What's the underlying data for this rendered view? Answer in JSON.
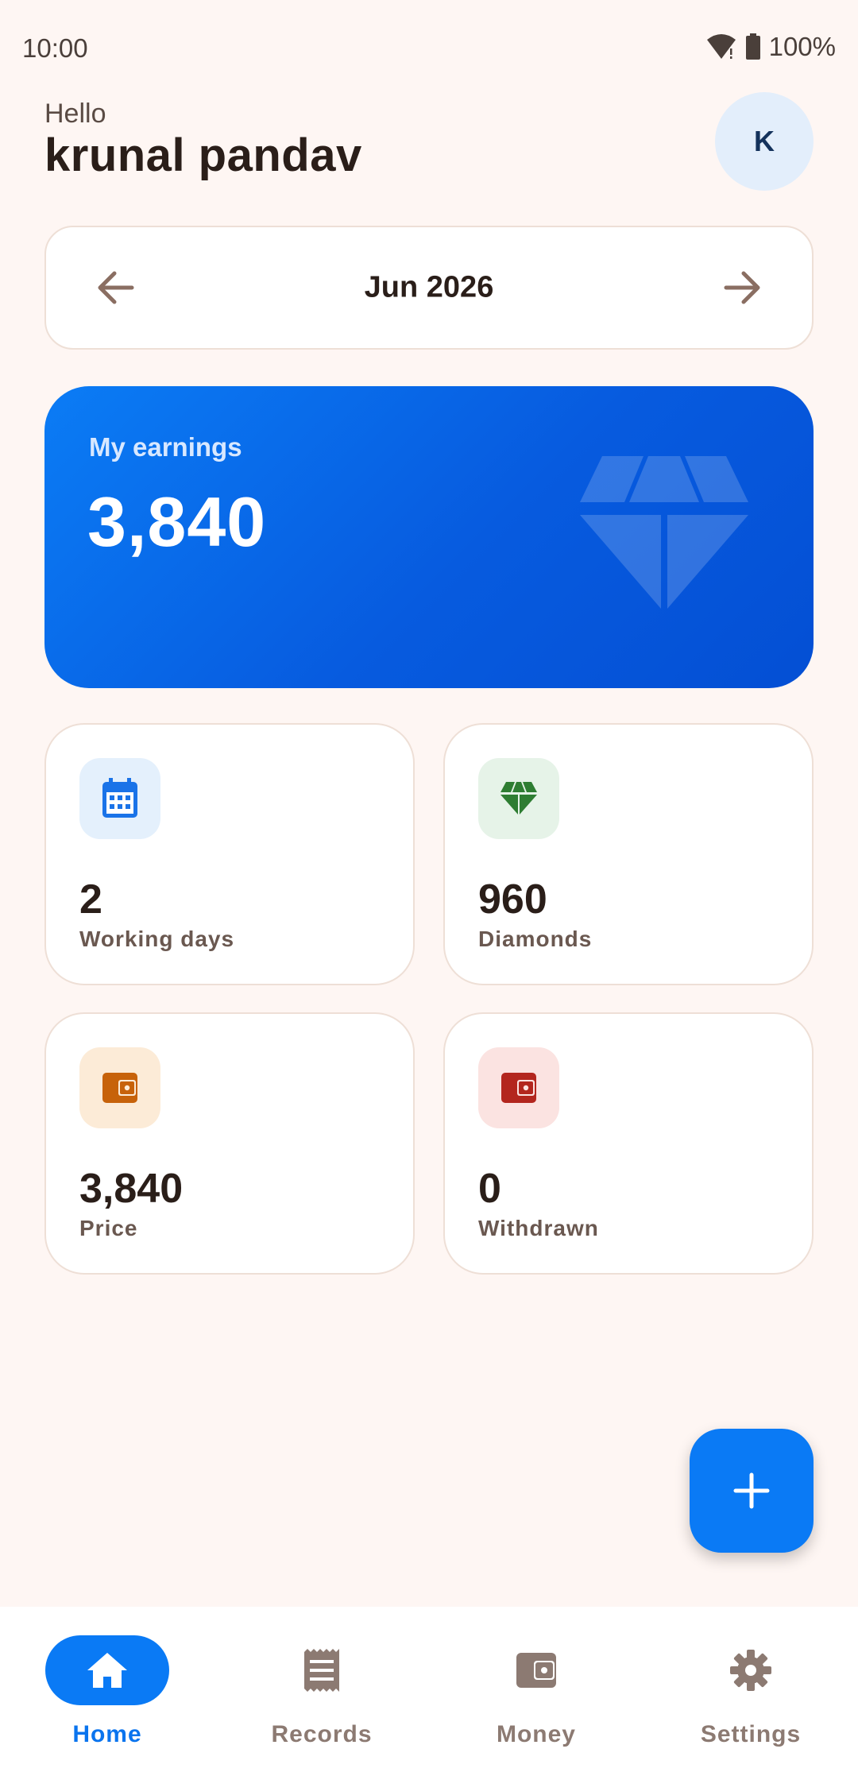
{
  "status_bar": {
    "time": "10:00",
    "battery": "100%"
  },
  "header": {
    "greeting": "Hello",
    "user_name": "krunal pandav",
    "avatar_initial": "K"
  },
  "month_selector": {
    "label": "Jun 2026",
    "prev_icon": "arrow-left-icon",
    "next_icon": "arrow-right-icon"
  },
  "earnings": {
    "label": "My earnings",
    "value": "3,840",
    "icon": "diamond-icon"
  },
  "stats": [
    {
      "value": "2",
      "label": "Working days",
      "icon": "calendar-icon",
      "icon_color": "#1A73E8",
      "icon_bg": "#E4F0FC"
    },
    {
      "value": "960",
      "label": "Diamonds",
      "icon": "diamond-icon",
      "icon_color": "#2E7D32",
      "icon_bg": "#E6F3E8"
    },
    {
      "value": "3,840",
      "label": "Price",
      "icon": "wallet-icon",
      "icon_color": "#C7620A",
      "icon_bg": "#FCEBD7"
    },
    {
      "value": "0",
      "label": "Withdrawn",
      "icon": "wallet-icon",
      "icon_color": "#B3261E",
      "icon_bg": "#FBE3E1"
    }
  ],
  "fab": {
    "icon": "plus-icon"
  },
  "bottom_nav": [
    {
      "label": "Home",
      "icon": "home-icon",
      "active": true
    },
    {
      "label": "Records",
      "icon": "receipt-icon",
      "active": false
    },
    {
      "label": "Money",
      "icon": "wallet-icon",
      "active": false
    },
    {
      "label": "Settings",
      "icon": "gear-icon",
      "active": false
    }
  ],
  "colors": {
    "accent": "#0A7AF5",
    "background": "#FEF6F3",
    "card_border": "#EEDFD6",
    "text_primary": "#2A1E19",
    "text_secondary": "#6A5850",
    "nav_inactive": "#8C7A72"
  }
}
